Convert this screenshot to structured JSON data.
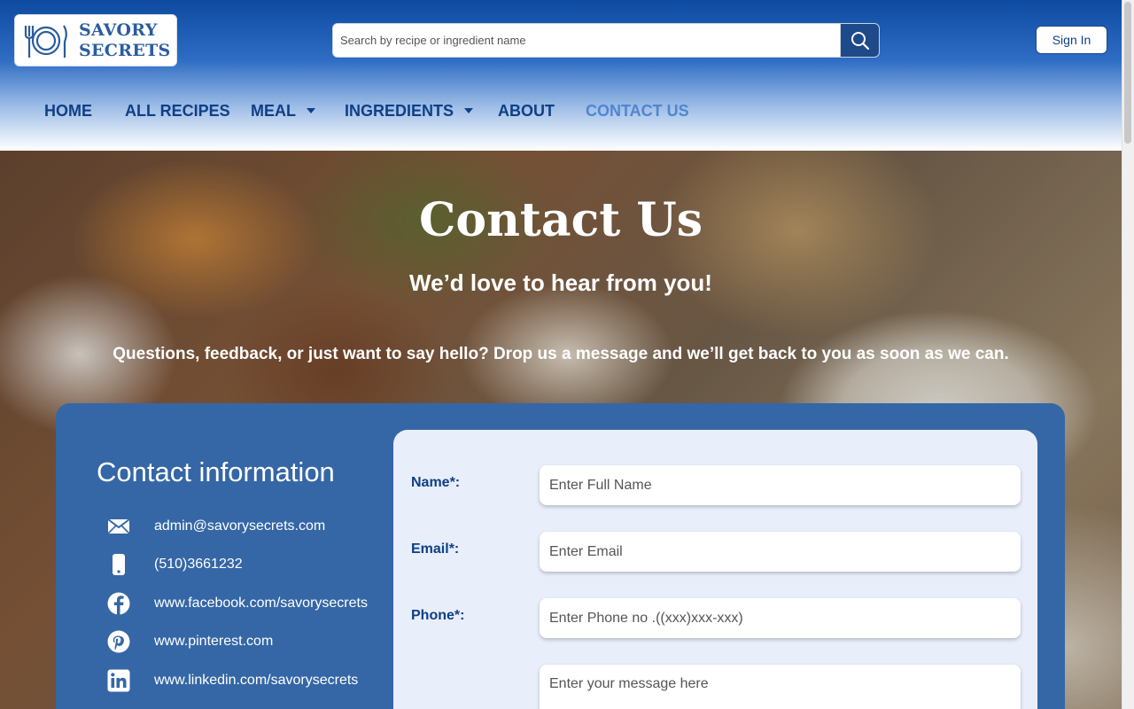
{
  "brand": {
    "line1": "SAVORY",
    "line2": "SECRETS"
  },
  "search": {
    "placeholder": "Search by recipe or ingredient name"
  },
  "header": {
    "signin_label": "Sign In"
  },
  "nav": {
    "home": "HOME",
    "all_recipes": "ALL RECIPES",
    "meal": "MEAL",
    "ingredients": "INGREDIENTS",
    "about": "ABOUT",
    "contact": "CONTACT US"
  },
  "hero": {
    "title": "Contact Us",
    "subtitle": "We’d love to hear from you!",
    "description": "Questions, feedback, or just want to say hello? Drop us a message and we’ll get back to you as soon as we can."
  },
  "contact_info": {
    "title": "Contact information",
    "items": [
      {
        "icon": "email-icon",
        "text": "admin@savorysecrets.com"
      },
      {
        "icon": "phone-icon",
        "text": "(510)3661232"
      },
      {
        "icon": "facebook-icon",
        "text": "www.facebook.com/savorysecrets"
      },
      {
        "icon": "pinterest-icon",
        "text": "www.pinterest.com"
      },
      {
        "icon": "linkedin-icon",
        "text": "www.linkedin.com/savorysecrets"
      }
    ]
  },
  "form": {
    "name_label": "Name*:",
    "name_placeholder": "Enter Full Name",
    "email_label": "Email*:",
    "email_placeholder": "Enter Email",
    "phone_label": "Phone*:",
    "phone_placeholder": "Enter Phone no .((xxx)xxx-xxx)",
    "message_placeholder": "Enter your message here"
  },
  "colors": {
    "brand_blue": "#0f3f86",
    "panel_blue": "#3567a6",
    "active_nav": "#4f86cf",
    "form_bg": "#e8eefa"
  }
}
